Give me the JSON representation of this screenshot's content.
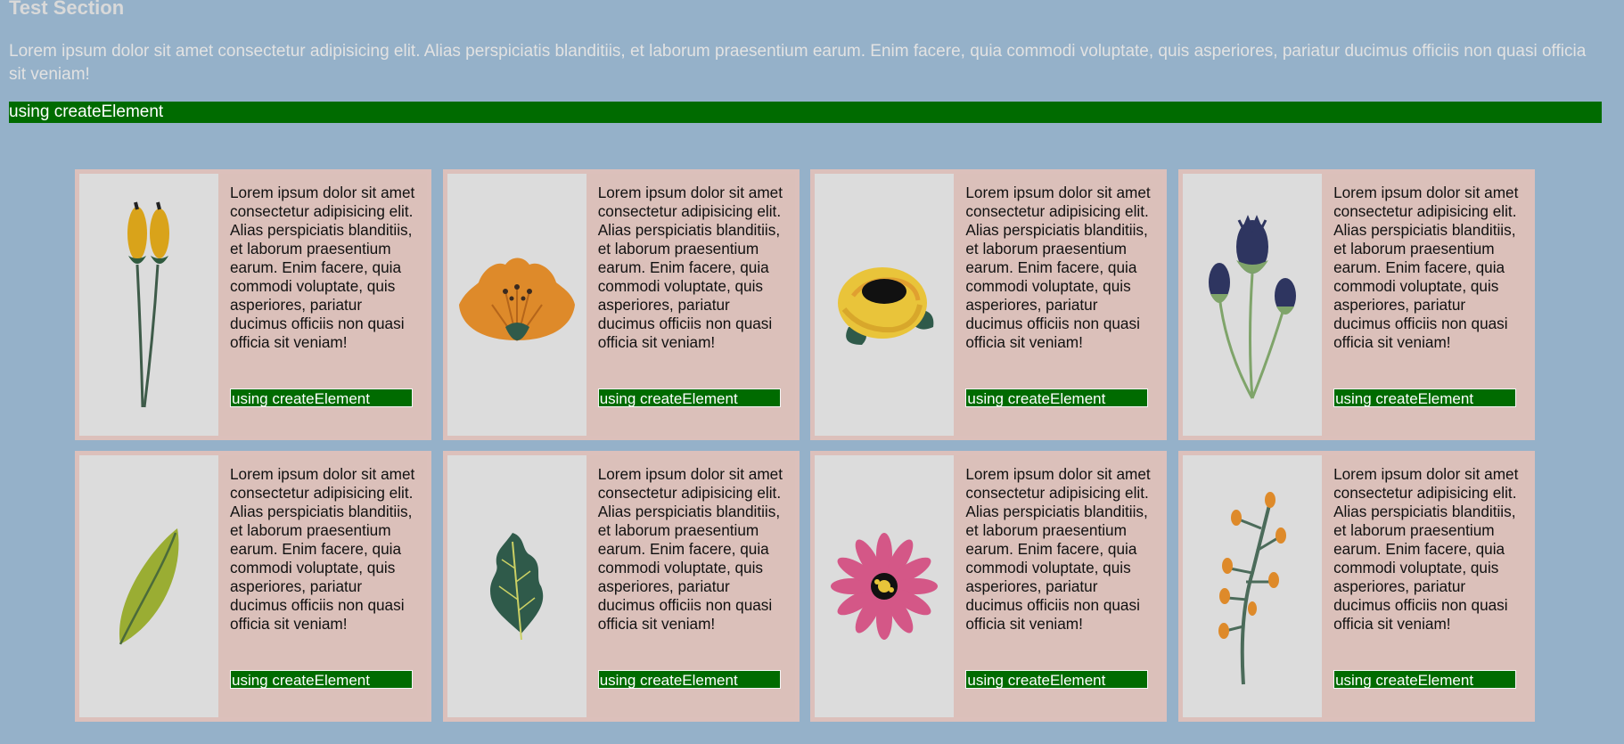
{
  "section": {
    "title": "Test Section",
    "description": "Lorem ipsum dolor sit amet consectetur adipisicing elit. Alias perspiciatis blanditiis, et laborum praesentium earum. Enim facere, quia commodi voluptate, quis asperiores, pariatur ducimus officiis non quasi officia sit veniam!",
    "banner_label": "using createElement"
  },
  "cards": [
    {
      "icon": "yellow-buds-flower-icon",
      "text": "Lorem ipsum dolor sit amet consectetur adipisicing elit. Alias perspiciatis blanditiis, et laborum praesentium earum. Enim facere, quia commodi voluptate, quis asperiores, pariatur ducimus officiis non quasi officia sit veniam!",
      "button_label": "using createElement"
    },
    {
      "icon": "orange-flower-icon",
      "text": "Lorem ipsum dolor sit amet consectetur adipisicing elit. Alias perspiciatis blanditiis, et laborum praesentium earum. Enim facere, quia commodi voluptate, quis asperiores, pariatur ducimus officiis non quasi officia sit veniam!",
      "button_label": "using createElement"
    },
    {
      "icon": "yellow-rose-icon",
      "text": "Lorem ipsum dolor sit amet consectetur adipisicing elit. Alias perspiciatis blanditiis, et laborum praesentium earum. Enim facere, quia commodi voluptate, quis asperiores, pariatur ducimus officiis non quasi officia sit veniam!",
      "button_label": "using createElement"
    },
    {
      "icon": "thistle-icon",
      "text": "Lorem ipsum dolor sit amet consectetur adipisicing elit. Alias perspiciatis blanditiis, et laborum praesentium earum. Enim facere, quia commodi voluptate, quis asperiores, pariatur ducimus officiis non quasi officia sit veniam!",
      "button_label": "using createElement"
    },
    {
      "icon": "olive-leaf-icon",
      "text": "Lorem ipsum dolor sit amet consectetur adipisicing elit. Alias perspiciatis blanditiis, et laborum praesentium earum. Enim facere, quia commodi voluptate, quis asperiores, pariatur ducimus officiis non quasi officia sit veniam!",
      "button_label": "using createElement"
    },
    {
      "icon": "green-leaf-icon",
      "text": "Lorem ipsum dolor sit amet consectetur adipisicing elit. Alias perspiciatis blanditiis, et laborum praesentium earum. Enim facere, quia commodi voluptate, quis asperiores, pariatur ducimus officiis non quasi officia sit veniam!",
      "button_label": "using createElement"
    },
    {
      "icon": "pink-daisy-icon",
      "text": "Lorem ipsum dolor sit amet consectetur adipisicing elit. Alias perspiciatis blanditiis, et laborum praesentium earum. Enim facere, quia commodi voluptate, quis asperiores, pariatur ducimus officiis non quasi officia sit veniam!",
      "button_label": "using createElement"
    },
    {
      "icon": "orange-berry-branch-icon",
      "text": "Lorem ipsum dolor sit amet consectetur adipisicing elit. Alias perspiciatis blanditiis, et laborum praesentium earum. Enim facere, quia commodi voluptate, quis asperiores, pariatur ducimus officiis non quasi officia sit veniam!",
      "button_label": "using createElement"
    }
  ]
}
